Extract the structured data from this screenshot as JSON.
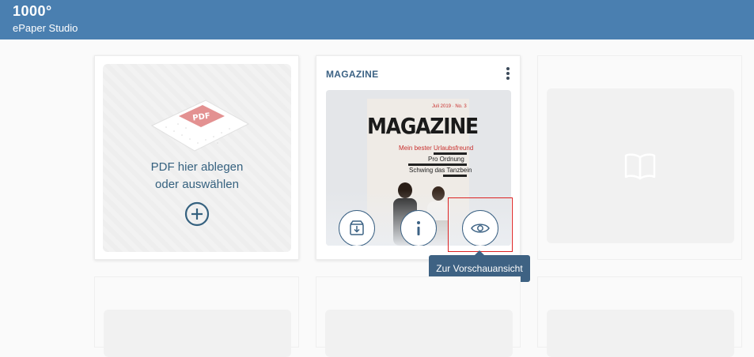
{
  "header": {
    "logo": "1000°",
    "app_name": "ePaper Studio",
    "bg_color": "#4a7fb0"
  },
  "upload_card": {
    "pdf_badge": "PDF",
    "line1": "PDF hier ablegen",
    "line2": "oder auswählen",
    "add_icon": "plus-circle-icon"
  },
  "magazine_card": {
    "title": "MAGAZINE",
    "menu_icon": "kebab-menu-icon",
    "cover": {
      "masthead": "MAGAZINE",
      "issue": "Juli 2019 · No. 3",
      "headline_red": "Mein bester Urlaubsfreund",
      "headline_2": "Pro Ordnung",
      "headline_3": "Schwing das Tanzbein"
    },
    "actions": [
      {
        "name": "download",
        "icon": "download-box-icon"
      },
      {
        "name": "info",
        "icon": "info-icon"
      },
      {
        "name": "preview",
        "icon": "eye-icon"
      }
    ],
    "tooltip": "Zur Vorschauansicht"
  },
  "empty_card": {
    "icon": "open-book-icon"
  },
  "colors": {
    "accent": "#3c6284",
    "highlight": "#dd2222"
  }
}
